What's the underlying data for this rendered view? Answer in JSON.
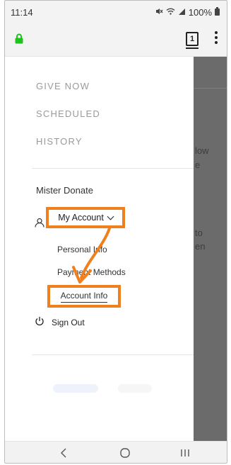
{
  "status_bar": {
    "time": "11:14",
    "battery": "100%"
  },
  "browser": {
    "tab_count": "1"
  },
  "drawer": {
    "nav": [
      {
        "label": "GIVE NOW"
      },
      {
        "label": "SCHEDULED"
      },
      {
        "label": "HISTORY"
      }
    ],
    "user_name": "Mister Donate",
    "account_toggle": "My Account",
    "sub_items": [
      {
        "label": "Personal Info"
      },
      {
        "label": "Payment Methods"
      },
      {
        "label": "Account Info"
      }
    ],
    "sign_out": "Sign Out"
  },
  "background_page": {
    "fragments": [
      "low",
      "e",
      "to",
      "en"
    ]
  },
  "colors": {
    "highlight": "#f0801e",
    "lock": "#1ec21e",
    "overlay": "#6b6b6b"
  },
  "icons": {
    "lock": "lock-icon",
    "user": "user-icon",
    "power": "power-icon",
    "back": "back-icon",
    "home": "home-icon",
    "recents": "recents-icon"
  }
}
